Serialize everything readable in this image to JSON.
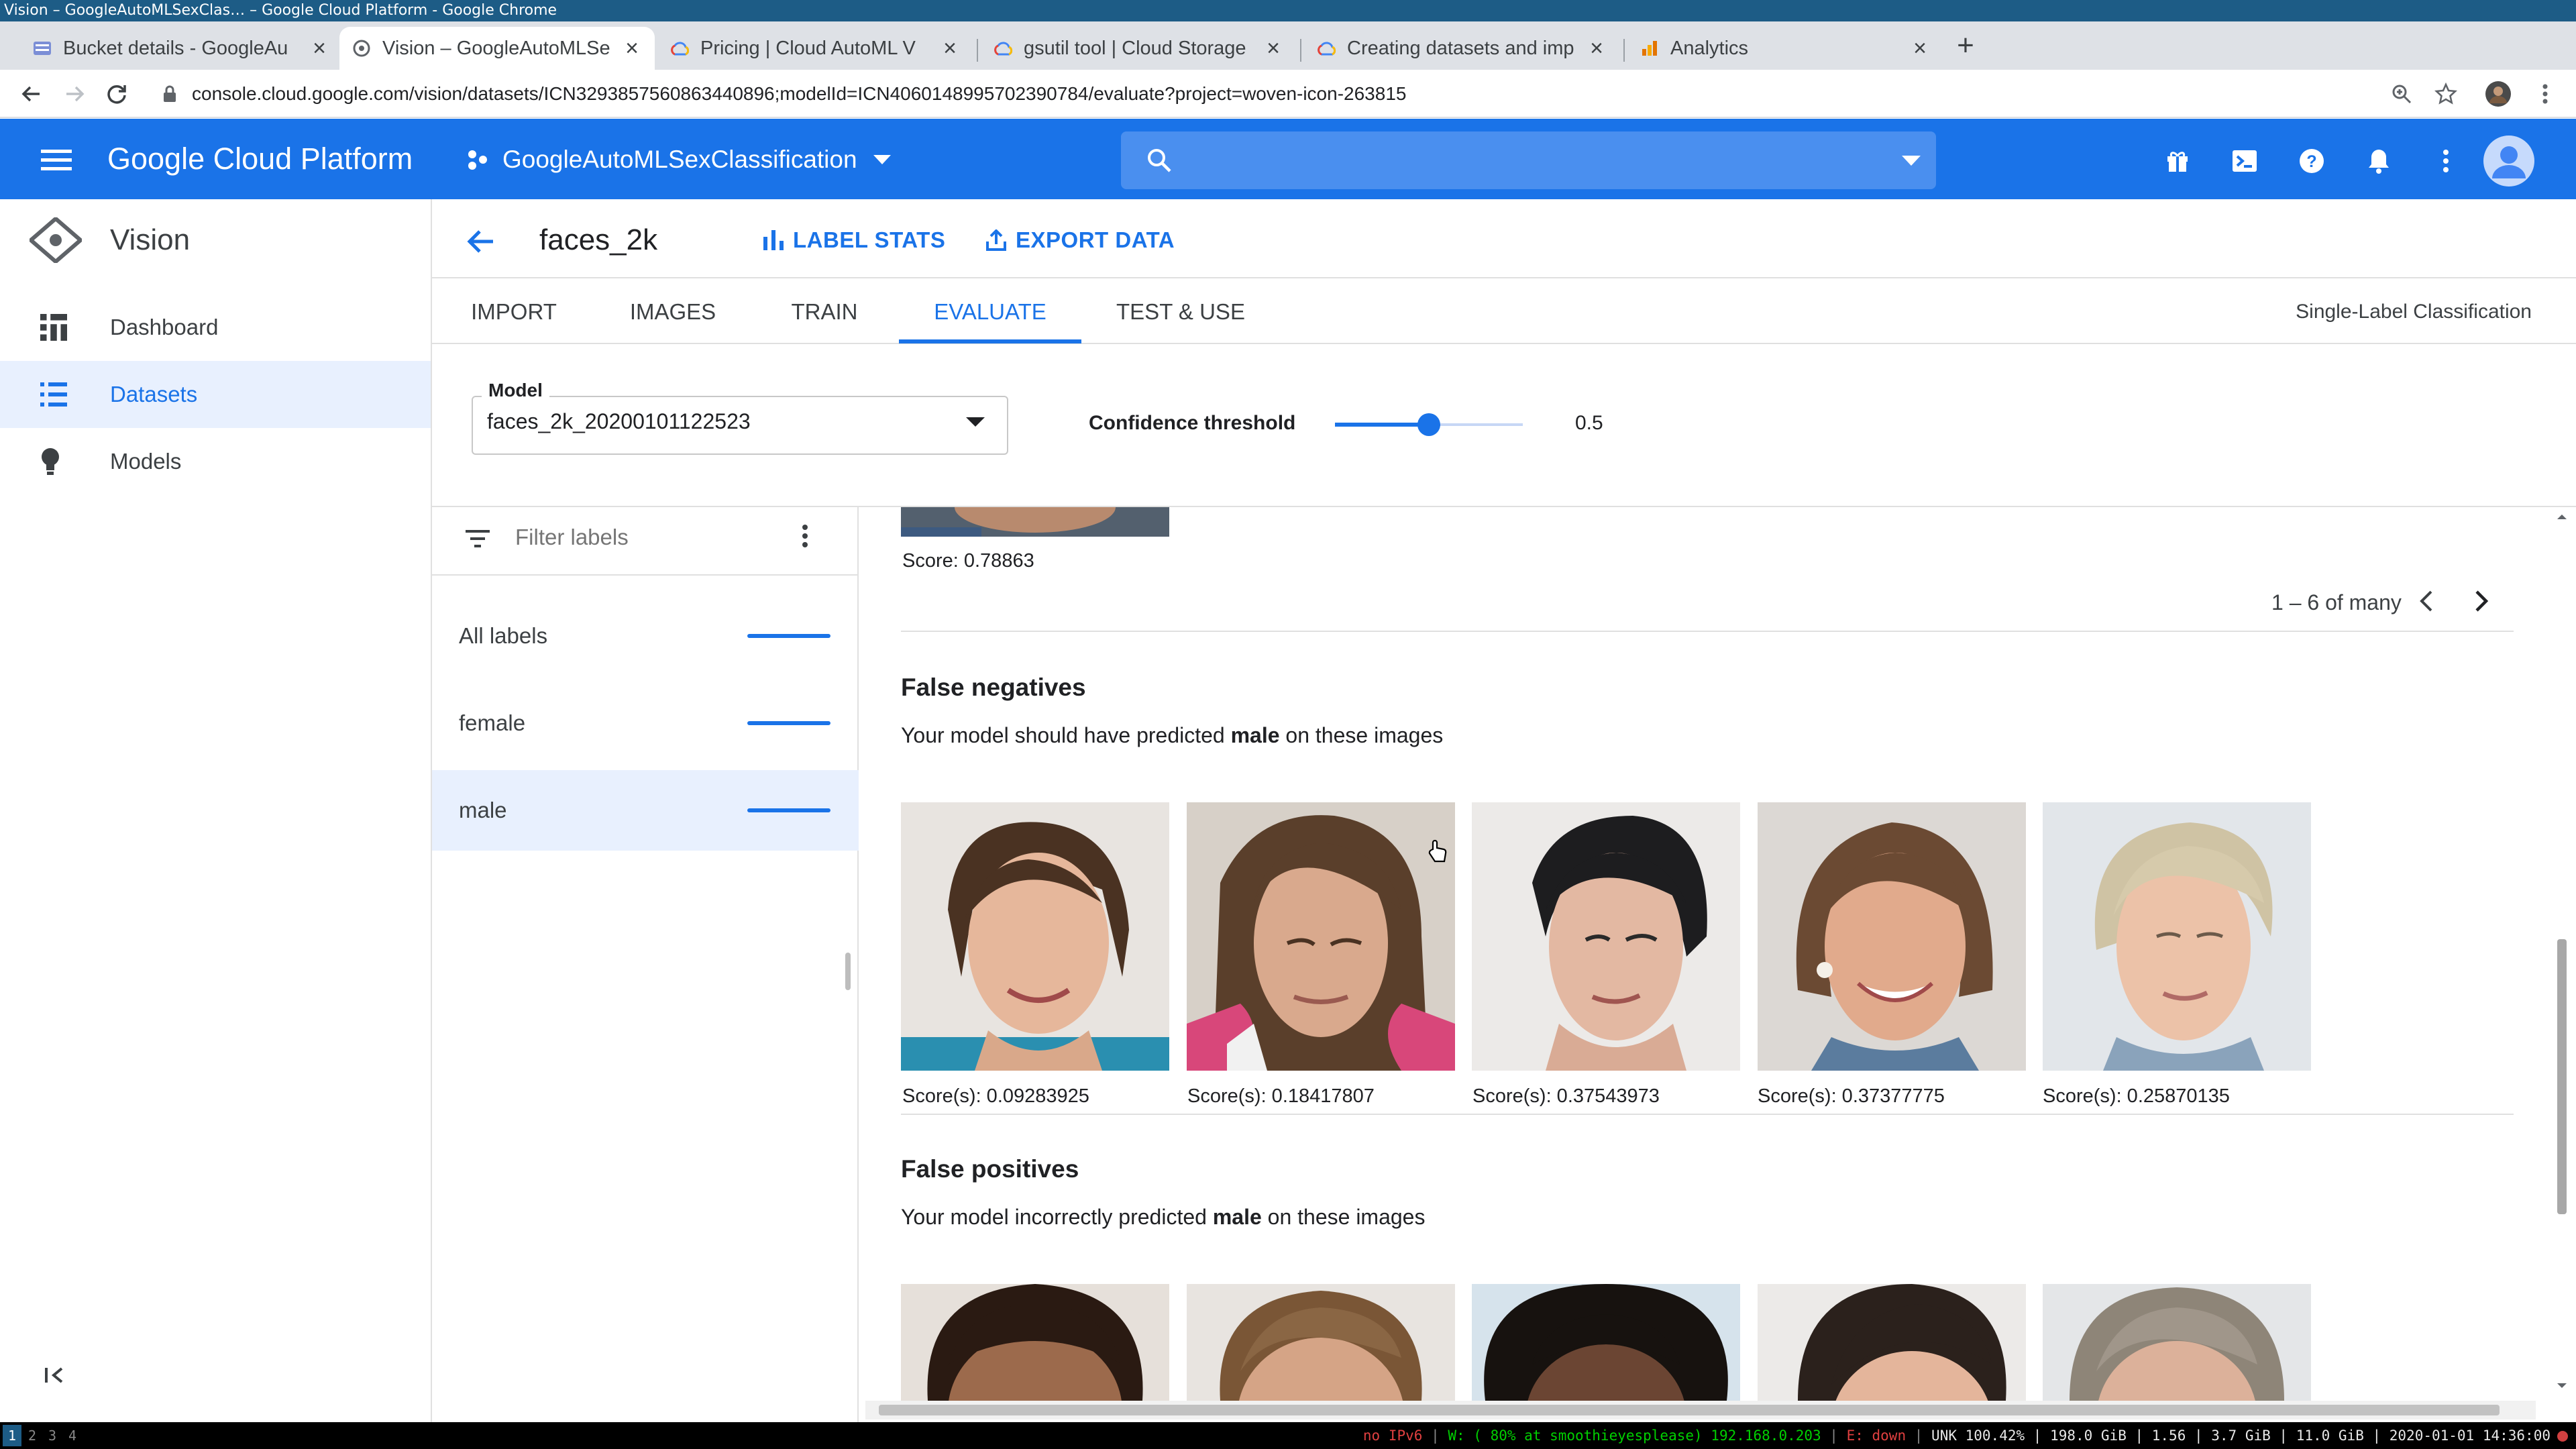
{
  "window": {
    "title": "Vision – GoogleAutoMLSexClas… – Google Cloud Platform - Google Chrome"
  },
  "browser": {
    "tabs": [
      {
        "title": "Bucket details - GoogleAu",
        "favicon": "storage-icon"
      },
      {
        "title": "Vision – GoogleAutoMLSe",
        "favicon": "vision-icon",
        "active": true
      },
      {
        "title": "Pricing  |  Cloud AutoML V",
        "favicon": "google-cloud-icon"
      },
      {
        "title": "gsutil tool  |  Cloud Storage",
        "favicon": "google-cloud-icon"
      },
      {
        "title": "Creating datasets and imp",
        "favicon": "google-cloud-icon"
      },
      {
        "title": "Analytics",
        "favicon": "analytics-icon"
      }
    ],
    "url": "console.cloud.google.com/vision/datasets/ICN3293857560863440896;modelId=ICN4060148995702390784/evaluate?project=woven-icon-263815"
  },
  "gcp": {
    "logo": "Google Cloud Platform",
    "project": "GoogleAutoMLSexClassification",
    "accent": "#1a73e8"
  },
  "nav": {
    "product": "Vision",
    "items": [
      {
        "label": "Dashboard",
        "icon": "dashboard-icon"
      },
      {
        "label": "Datasets",
        "icon": "list-icon",
        "selected": true
      },
      {
        "label": "Models",
        "icon": "lightbulb-icon"
      }
    ]
  },
  "page": {
    "dataset": "faces_2k",
    "actions": {
      "label_stats": "LABEL STATS",
      "export": "EXPORT DATA"
    },
    "tabs": [
      "IMPORT",
      "IMAGES",
      "TRAIN",
      "EVALUATE",
      "TEST & USE"
    ],
    "active_tab": "EVALUATE",
    "classification_type": "Single-Label Classification"
  },
  "model": {
    "label": "Model",
    "value": "faces_2k_20200101122523",
    "confidence_label": "Confidence threshold",
    "confidence_value": "0.5",
    "confidence_fraction": 0.5
  },
  "labels_panel": {
    "filter_placeholder": "Filter labels",
    "items": [
      "All labels",
      "female",
      "male"
    ],
    "selected": "male"
  },
  "results": {
    "previous_score": "Score: 0.78863",
    "pagination": "1 – 6 of many",
    "false_negatives": {
      "title": "False negatives",
      "text_before": "Your model should have predicted ",
      "label": "male",
      "text_after": " on these images",
      "scores": [
        "Score(s): 0.09283925",
        "Score(s): 0.18417807",
        "Score(s): 0.37543973",
        "Score(s): 0.37377775",
        "Score(s): 0.25870135"
      ]
    },
    "false_positives": {
      "title": "False positives",
      "text_before": "Your model incorrectly predicted ",
      "label": "male",
      "text_after": " on these images"
    }
  },
  "statusbar": {
    "workspaces": [
      "1",
      "2",
      "3",
      "4"
    ],
    "ipv6": "no IPv6",
    "wifi": "W: ( 80% at smoothieyesplease) 192.168.0.203",
    "eth": "E: down",
    "stats": "UNK 100.42% | 198.0 GiB | 1.56 | 3.7 GiB | 11.0 GiB | 2020-01-01 14:36:00"
  }
}
